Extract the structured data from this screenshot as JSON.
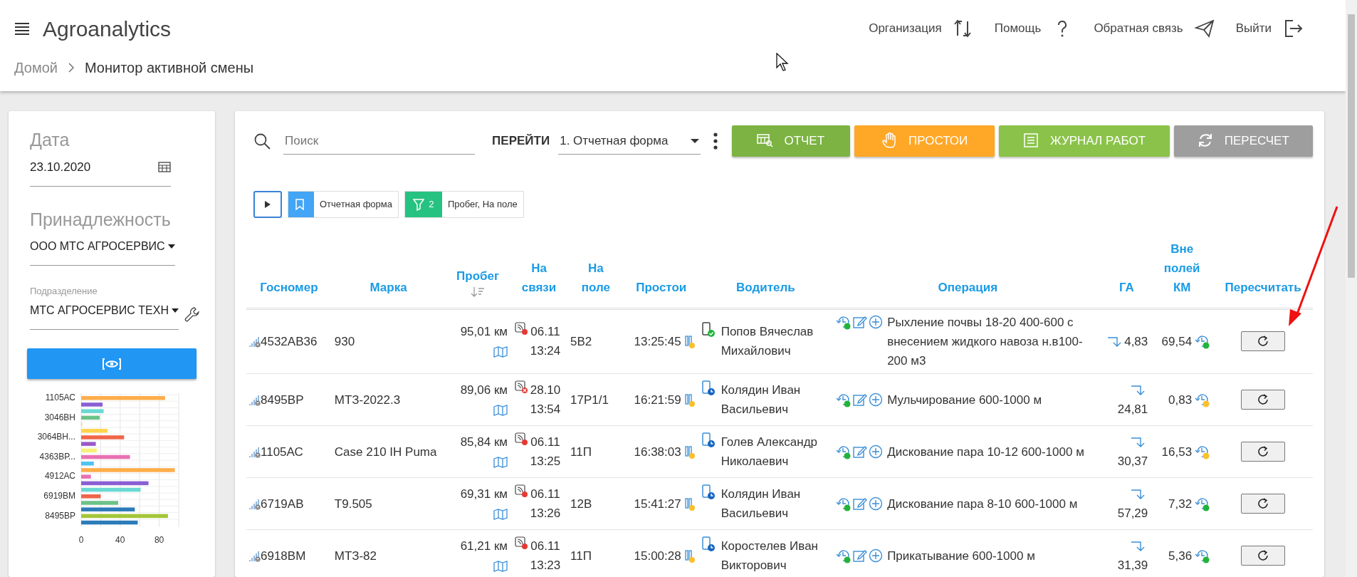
{
  "header": {
    "app_title": "Agroanalytics",
    "nav": [
      {
        "label": "Организация",
        "kind": "swap"
      },
      {
        "label": "Помощь",
        "kind": "help"
      },
      {
        "label": "Обратная связь",
        "kind": "send"
      },
      {
        "label": "Выйти",
        "kind": "logout"
      }
    ],
    "breadcrumb": [
      {
        "label": "Домой",
        "selected": false
      },
      {
        "label": "Монитор активной смены",
        "selected": true
      }
    ]
  },
  "filters": {
    "date": {
      "label": "Дата",
      "value": "23.10.2020"
    },
    "ownership": {
      "label": "Принадлежность",
      "value": "ООО МТС АГРОСЕРВИС"
    },
    "subdivision": {
      "label": "Подразделение",
      "value": "МТС АГРОСЕРВИС ТЕХН"
    },
    "chart_data": {
      "type": "bar",
      "orientation": "horizontal",
      "xlim": [
        0,
        100
      ],
      "xticks": [
        0,
        40,
        80
      ],
      "categories": [
        "1105АС",
        null,
        null,
        "3046ВН",
        null,
        null,
        "3064ВН...",
        null,
        null,
        "4363ВР...",
        null,
        null,
        "4912АС",
        null,
        null,
        "6919ВМ",
        null,
        null,
        "8495ВР",
        null
      ],
      "values": [
        86,
        22,
        23,
        19,
        1,
        27,
        44,
        15,
        16,
        50,
        13,
        96,
        10,
        69,
        61,
        20,
        38,
        55,
        89,
        58
      ],
      "colors": [
        "#ffad4a",
        "#8a5fd3",
        "#6ad9d3",
        "#6cc287",
        "#ffd34d",
        "#ffd34d",
        "#f0654a",
        "#9b59c7",
        "#f7f07a",
        "#e970b3",
        "#4fc3f0",
        "#ffad4a",
        "#e970b3",
        "#8a5fd3",
        "#6ad9d3",
        "#f0654a",
        "#6cc287",
        "#2b7bb9",
        "#a4c639",
        "#2b7bb9"
      ]
    }
  },
  "toolbar": {
    "search": {
      "placeholder": "Поиск"
    },
    "goto_label": "ПЕРЕЙТИ",
    "goto_value": "1. Отчетная форма",
    "buttons": [
      {
        "label": "ОТЧЕТ",
        "kind": "report",
        "color": "#7cb342"
      },
      {
        "label": "ПРОСТОИ",
        "kind": "hand",
        "color": "#ffa726"
      },
      {
        "label": "ЖУРНАЛ РАБОТ",
        "kind": "list",
        "color": "#8bc34a"
      },
      {
        "label": "ПЕРЕСЧЕТ",
        "kind": "refresh",
        "color": "#9e9e9e"
      }
    ]
  },
  "chips": [
    {
      "kind": "bookmark",
      "label": "Отчетная форма",
      "color": "#42a5f5"
    },
    {
      "kind": "filter",
      "count": "2",
      "label": "Пробег, На поле",
      "color": "#26c281"
    }
  ],
  "table": {
    "columns": [
      "Госномер",
      "Марка",
      "Пробег",
      "На связи",
      "На поле",
      "Простои",
      "Водитель",
      "Операция",
      "ГА",
      "Вне полей КМ",
      "Пересчитать"
    ],
    "rows": [
      {
        "plate": "4532АВ36",
        "brand": "930",
        "mileage": "95,01 км",
        "link": {
          "kind": "dot",
          "text": "06.11 13:24"
        },
        "field": "5В2",
        "idle": "13:25:45",
        "driver": {
          "kind": "check",
          "name": "Попов Вячеслав Михайлович"
        },
        "operation": "Рыхление почвы 18-20 400-600 с внесением жидкого навоза н.в100-200 м3",
        "ha": "4,83",
        "off_field": {
          "value": "69,54",
          "color": "#22b33a"
        }
      },
      {
        "plate": "8495ВР",
        "brand": "МТЗ-2022.3",
        "mileage": "89,06 км",
        "link": {
          "kind": "cross",
          "text": "28.10 13:54"
        },
        "field": "17Р1/1",
        "idle": "16:21:59",
        "driver": {
          "kind": "clock",
          "name": "Колядин Иван Васильевич"
        },
        "operation": "Мульчирование 600-1000 м",
        "ha": "24,81",
        "off_field": {
          "value": "0,83",
          "color": "#fbc02d"
        }
      },
      {
        "plate": "1105АС",
        "brand": "Case 210 IH Puma",
        "mileage": "85,84 км",
        "link": {
          "kind": "dot",
          "text": "06.11 13:25"
        },
        "field": "11П",
        "idle": "16:38:03",
        "driver": {
          "kind": "clock",
          "name": "Голев Александр Николаевич"
        },
        "operation": "Дискование пара 10-12 600-1000 м",
        "ha": "30,37",
        "off_field": {
          "value": "16,53",
          "color": "#fbc02d"
        }
      },
      {
        "plate": "6719АВ",
        "brand": "T9.505",
        "mileage": "69,31 км",
        "link": {
          "kind": "dot",
          "text": "06.11 13:26"
        },
        "field": "12В",
        "idle": "15:41:27",
        "driver": {
          "kind": "clock",
          "name": "Колядин Иван Васильевич"
        },
        "operation": "Дискование пара 8-10 600-1000 м",
        "ha": "57,29",
        "off_field": {
          "value": "7,32",
          "color": "#22b33a"
        }
      },
      {
        "plate": "6918ВМ",
        "brand": "МТЗ-82",
        "mileage": "61,21 км",
        "link": {
          "kind": "dot",
          "text": "06.11 13:23"
        },
        "field": "11П",
        "idle": "15:00:28",
        "driver": {
          "kind": "clock",
          "name": "Коростелев Иван Викторович"
        },
        "operation": "Прикатывание 600-1000 м",
        "ha": "31,39",
        "off_field": {
          "value": "5,36",
          "color": "#22b33a"
        }
      }
    ]
  }
}
